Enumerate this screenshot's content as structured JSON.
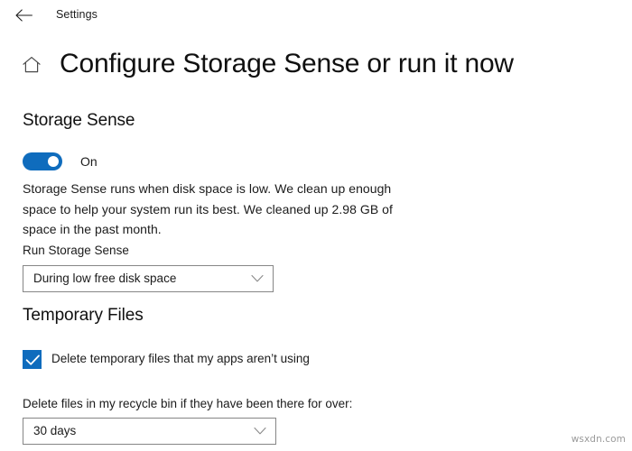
{
  "window": {
    "app_title": "Settings",
    "back_icon": "back-arrow-icon"
  },
  "header": {
    "home_icon": "home-icon",
    "page_title": "Configure Storage Sense or run it now"
  },
  "sections": {
    "storage_sense": {
      "heading": "Storage Sense",
      "toggle": {
        "state_label": "On",
        "checked": true,
        "accent_color": "#0f6cbd"
      },
      "description": "Storage Sense runs when disk space is low. We clean up enough space to help your system run its best. We cleaned up 2.98 GB of space in the past month.",
      "run_field": {
        "label": "Run Storage Sense",
        "selected_value": "During low free disk space",
        "chevron_icon": "chevron-down-icon"
      }
    },
    "temporary_files": {
      "heading": "Temporary Files",
      "checkbox": {
        "label": "Delete temporary files that my apps aren’t using",
        "checked": true,
        "accent_color": "#0f6cbd",
        "check_icon": "check-icon"
      },
      "recycle_bin_field": {
        "label": "Delete files in my recycle bin if they have been there for over:",
        "selected_value": "30 days",
        "chevron_icon": "chevron-down-icon"
      }
    }
  },
  "watermark": {
    "text": "wsxdn.com"
  }
}
